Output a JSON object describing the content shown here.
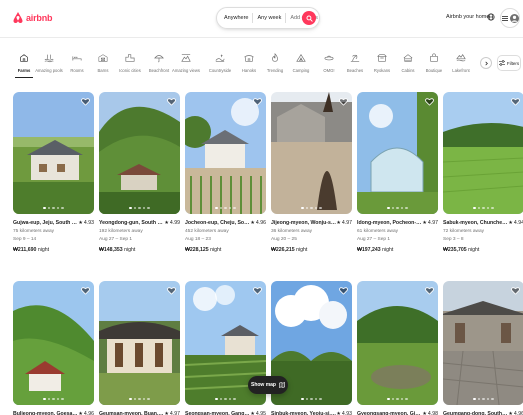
{
  "brand": {
    "name": "airbnb",
    "color": "#ff385c"
  },
  "search": {
    "where": "Anywhere",
    "when": "Any week",
    "guests": "Add guests"
  },
  "header": {
    "host_link": "Airbnb your home"
  },
  "categories": [
    {
      "label": "Farms",
      "icon": "farm-icon",
      "active": true
    },
    {
      "label": "Amazing pools",
      "icon": "pool-icon"
    },
    {
      "label": "Rooms",
      "icon": "bed-icon"
    },
    {
      "label": "Barns",
      "icon": "barn-icon"
    },
    {
      "label": "Iconic cities",
      "icon": "city-icon"
    },
    {
      "label": "Beachfront",
      "icon": "umbrella-icon"
    },
    {
      "label": "Amazing views",
      "icon": "view-icon"
    },
    {
      "label": "Countryside",
      "icon": "countryside-icon"
    },
    {
      "label": "Hanoks",
      "icon": "hanok-icon"
    },
    {
      "label": "Trending",
      "icon": "fire-icon"
    },
    {
      "label": "Camping",
      "icon": "tent-icon"
    },
    {
      "label": "OMG!",
      "icon": "ufo-icon"
    },
    {
      "label": "Beaches",
      "icon": "beach-icon"
    },
    {
      "label": "Ryokans",
      "icon": "ryokan-icon"
    },
    {
      "label": "Cabins",
      "icon": "cabin-icon"
    },
    {
      "label": "Boutique",
      "icon": "boutique-icon"
    },
    {
      "label": "Lakefront",
      "icon": "lake-icon"
    }
  ],
  "filters_label": "Filters",
  "show_map_label": "Show map",
  "listings": [
    {
      "location": "Gujwa-eup, Jeju, South Korea",
      "rating": "4.93",
      "distance": "75 kilometers away",
      "dates": "Sep 9 – 14",
      "price": "₩211,690",
      "unit": "night",
      "scene": "farmhouse"
    },
    {
      "location": "Yeongdong-gun, South Korea",
      "rating": "4.99",
      "distance": "192 kilometers away",
      "dates": "Aug 27 – Sep 1",
      "price": "₩148,353",
      "unit": "night",
      "scene": "mountain"
    },
    {
      "location": "Jocheon-eup, Cheju, South Korea",
      "rating": "4.96",
      "distance": "452 kilometers away",
      "dates": "Aug 18 – 23",
      "price": "₩228,125",
      "unit": "night",
      "scene": "garden"
    },
    {
      "location": "Jijeong-myeon, Wonju-si, South Korea",
      "rating": "4.97",
      "distance": "36 kilometers away",
      "dates": "Aug 20 – 25",
      "price": "₩226,215",
      "unit": "night",
      "scene": "sculpture"
    },
    {
      "location": "Idong-myeon, Pocheon-si, South Korea",
      "rating": "4.97",
      "distance": "61 kilometers away",
      "dates": "Aug 27 – Sep 1",
      "price": "₩197,243",
      "unit": "night",
      "scene": "greenhouse"
    },
    {
      "location": "Sabuk-myeon, Chuncheon, South Korea",
      "rating": "4.94",
      "distance": "72 kilometers away",
      "dates": "Sep 3 – 8",
      "price": "₩235,705",
      "unit": "night",
      "scene": "ricefield"
    },
    {
      "location": "Buljeong-myeon, Goesan, South Korea",
      "rating": "4.96",
      "distance": "",
      "dates": "",
      "price": "",
      "unit": "",
      "scene": "hillhouse"
    },
    {
      "location": "Geumsan-myeon, Buan, South Korea",
      "rating": "4.97",
      "distance": "",
      "dates": "",
      "price": "",
      "unit": "",
      "scene": "hanok"
    },
    {
      "location": "Seongsan-myeon, Gangneung, South Korea",
      "rating": "4.95",
      "distance": "",
      "dates": "",
      "price": "",
      "unit": "",
      "scene": "vineyard"
    },
    {
      "location": "Sinbuk-myeon, Yeoju-si, South Korea",
      "rating": "4.93",
      "distance": "",
      "dates": "",
      "price": "",
      "unit": "",
      "scene": "clouds"
    },
    {
      "location": "Gyeongsang-myeon, Gimpo-si, South Korea",
      "rating": "4.98",
      "distance": "",
      "dates": "",
      "price": "",
      "unit": "",
      "scene": "pond"
    },
    {
      "location": "Geumgang-dong, South Korea",
      "rating": "4.96",
      "distance": "",
      "dates": "",
      "price": "",
      "unit": "",
      "scene": "stone"
    }
  ]
}
